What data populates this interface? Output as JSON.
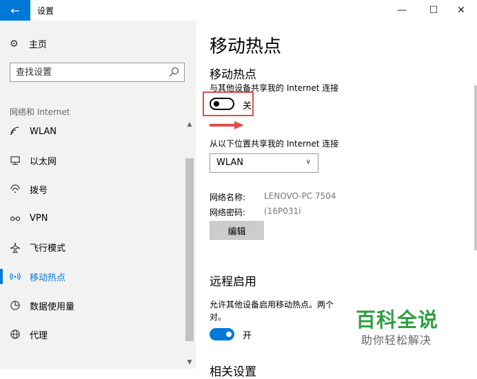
{
  "window": {
    "title": "设置",
    "back_glyph": "←",
    "minimize_glyph": "—",
    "maximize_glyph": "☐",
    "close_glyph": "✕",
    "accent_color": "#0078d7"
  },
  "sidebar": {
    "home_label": "主页",
    "search_placeholder": "查找设置",
    "section_label": "网络和 Internet",
    "items": [
      {
        "label": "WLAN",
        "icon": "wifi-icon"
      },
      {
        "label": "以太网",
        "icon": "ethernet-icon"
      },
      {
        "label": "拨号",
        "icon": "dialup-icon"
      },
      {
        "label": "VPN",
        "icon": "vpn-icon"
      },
      {
        "label": "飞行模式",
        "icon": "airplane-icon"
      },
      {
        "label": "移动热点",
        "icon": "hotspot-icon",
        "active": true
      },
      {
        "label": "数据使用量",
        "icon": "data-usage-icon"
      },
      {
        "label": "代理",
        "icon": "globe-icon"
      }
    ]
  },
  "main": {
    "page_title": "移动热点",
    "hotspot": {
      "heading": "移动热点",
      "description": "与其他设备共享我的 Internet 连接",
      "toggle_label": "关",
      "toggle_on": false
    },
    "share_from": {
      "label": "从以下位置共享我的 Internet 连接",
      "selected": "WLAN"
    },
    "network_name_key": "网络名称:",
    "network_name_value": "LENOVO-PC 7504",
    "network_password_key": "网络密码:",
    "network_password_value": "(16P031i",
    "edit_label": "编辑",
    "remote": {
      "heading": "远程启用",
      "description_line1": "允许其他设备启用移动热点。两个",
      "description_line2": "对。",
      "toggle_label": "开",
      "toggle_on": true
    },
    "related_heading": "相关设置"
  },
  "watermark": {
    "title": "百科全说",
    "subtitle": "助你轻松解决"
  },
  "annotation_color": "#e24b4b"
}
